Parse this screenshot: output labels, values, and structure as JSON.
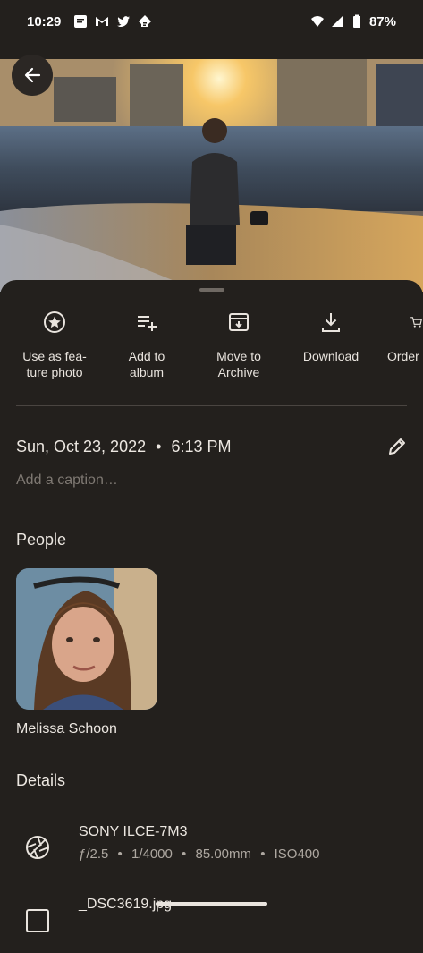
{
  "status_bar": {
    "time": "10:29",
    "battery": "87%",
    "notification_icons": [
      "message-icon",
      "gmail-icon",
      "twitter-icon",
      "feedly-icon"
    ],
    "system_icons": [
      "wifi-icon",
      "signal-icon",
      "battery-icon"
    ]
  },
  "photo": {
    "description_icon": "beach-sunset-photo"
  },
  "actions": [
    {
      "icon": "star-circle-icon",
      "label": "Use as fea-\nture photo"
    },
    {
      "icon": "playlist-add-icon",
      "label": "Add to\nalbum"
    },
    {
      "icon": "archive-icon",
      "label": "Move to\nArchive"
    },
    {
      "icon": "download-icon",
      "label": "Download"
    },
    {
      "icon": "cart-icon",
      "label": "Order"
    }
  ],
  "info": {
    "date": "Sun, Oct 23, 2022",
    "time": "6:13 PM",
    "separator": "•",
    "caption_placeholder": "Add a caption…"
  },
  "people": {
    "title": "People",
    "items": [
      {
        "name": "Melissa Schoon"
      }
    ]
  },
  "details": {
    "title": "Details",
    "camera": {
      "model": "SONY ILCE-7M3",
      "aperture": "ƒ/2.5",
      "shutter": "1/4000",
      "focal": "85.00mm",
      "iso": "ISO400",
      "sep": "•"
    },
    "file": {
      "name": "_DSC3619.jpg"
    }
  },
  "colors": {
    "background": "#23201d",
    "text": "#e9e4de",
    "muted": "#7f7973"
  }
}
